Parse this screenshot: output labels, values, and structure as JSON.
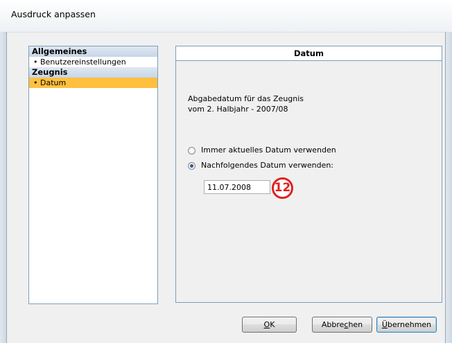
{
  "window": {
    "title": "Ausdruck anpassen"
  },
  "nav": {
    "groups": [
      {
        "label": "Allgemeines",
        "items": [
          {
            "label": "Benutzereinstellungen",
            "selected": false
          }
        ]
      },
      {
        "label": "Zeugnis",
        "items": [
          {
            "label": "Datum",
            "selected": true
          }
        ]
      }
    ],
    "bullet": "•"
  },
  "panel": {
    "header": "Datum",
    "description_line1": "Abgabedatum für das Zeugnis",
    "description_line2": "vom 2. Halbjahr - 2007/08",
    "radio_current": {
      "label": "Immer aktuelles Datum verwenden",
      "checked": false
    },
    "radio_following": {
      "label": "Nachfolgendes Datum verwenden:",
      "checked": true
    },
    "date_value": "11.07.2008",
    "badge": "12"
  },
  "buttons": {
    "ok": {
      "before": "",
      "mnemonic": "O",
      "after": "K"
    },
    "cancel": {
      "before": "Abbre",
      "mnemonic": "c",
      "after": "hen"
    },
    "apply": {
      "before": "",
      "mnemonic": "Ü",
      "after": "bernehmen"
    }
  },
  "colors": {
    "selection": "#ffc040",
    "border": "#7f9db9",
    "badge": "#e02020"
  }
}
